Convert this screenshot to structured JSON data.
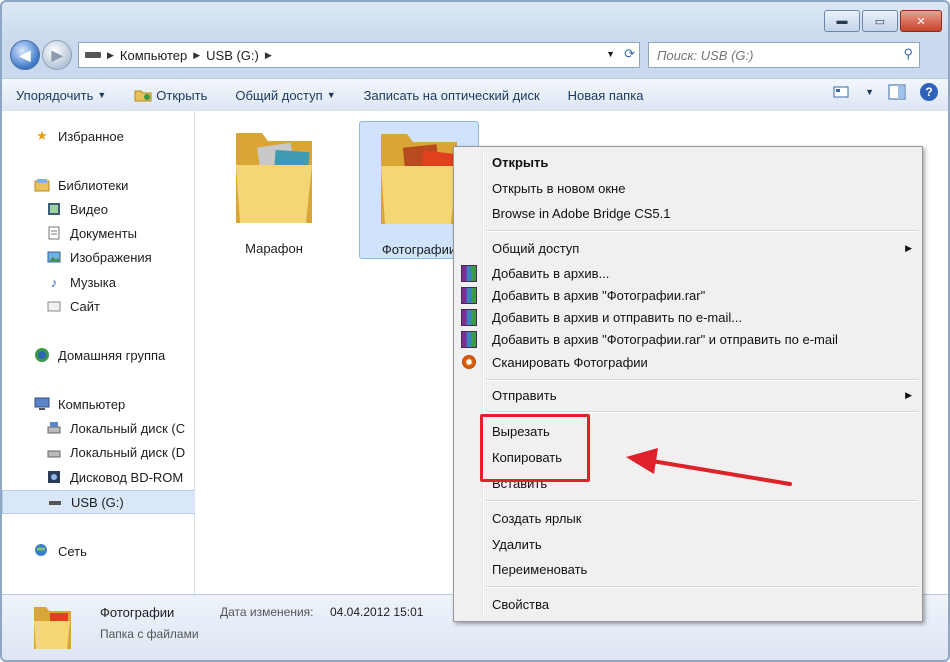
{
  "window": {
    "buttons": {
      "minimize": "▬",
      "maximize": "▭",
      "close": "✕"
    }
  },
  "address": {
    "crumbs": [
      "Компьютер",
      "USB (G:)"
    ]
  },
  "search": {
    "placeholder": "Поиск: USB (G:)"
  },
  "toolbar": {
    "organize": "Упорядочить",
    "open": "Открыть",
    "share": "Общий доступ",
    "burn": "Записать на оптический диск",
    "new_folder": "Новая папка"
  },
  "sidebar": {
    "favorites": "Избранное",
    "libraries": "Библиотеки",
    "library_items": [
      "Видео",
      "Документы",
      "Изображения",
      "Музыка",
      "Сайт"
    ],
    "homegroup": "Домашняя группа",
    "computer": "Компьютер",
    "computer_items": [
      "Локальный диск (C",
      "Локальный диск (D",
      "Дисковод BD-ROM",
      "USB (G:)"
    ],
    "network": "Сеть"
  },
  "folders": [
    {
      "label": "Марафон",
      "selected": false
    },
    {
      "label": "Фотографии",
      "selected": true
    }
  ],
  "context_menu": {
    "items": [
      "Открыть",
      "Открыть в новом окне",
      "Browse in Adobe Bridge CS5.1",
      "Общий доступ",
      "Добавить в архив...",
      "Добавить в архив \"Фотографии.rar\"",
      "Добавить в архив и отправить по e-mail...",
      "Добавить в архив \"Фотографии.rar\" и отправить по e-mail",
      "Сканировать Фотографии",
      "Отправить",
      "Вырезать",
      "Копировать",
      "Вставить",
      "Создать ярлык",
      "Удалить",
      "Переименовать",
      "Свойства"
    ]
  },
  "status": {
    "name": "Фотографии",
    "type": "Папка с файлами",
    "date_label": "Дата изменения:",
    "date_value": "04.04.2012 15:01"
  },
  "colors": {
    "highlight": "#e0202a",
    "selection": "#cfe3fb",
    "accent": "#2e63b8"
  }
}
